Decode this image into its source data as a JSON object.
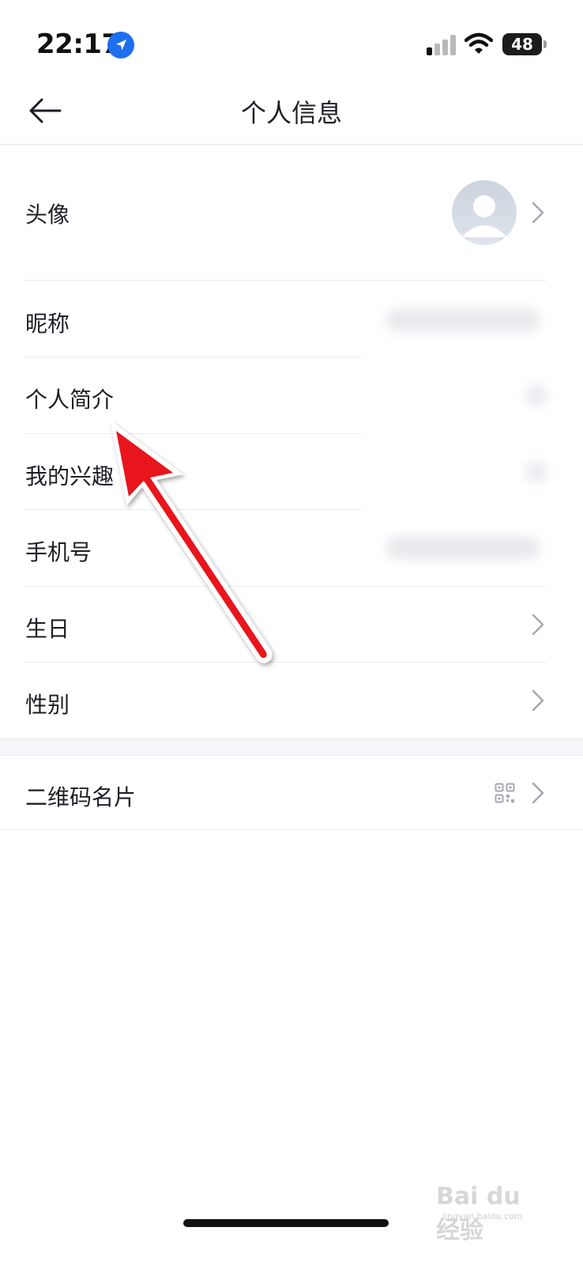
{
  "status_bar": {
    "time": "22:17",
    "battery": "48",
    "icons": [
      "location-arrow-icon",
      "cellular-signal-icon",
      "wifi-icon",
      "battery-icon"
    ]
  },
  "nav": {
    "title": "个人信息",
    "back_icon": "arrow-left-icon"
  },
  "profile_rows": [
    {
      "label": "头像",
      "value_type": "avatar"
    },
    {
      "label": "昵称",
      "value_type": "blurred"
    },
    {
      "label": "个人简介",
      "value_type": "blurred"
    },
    {
      "label": "我的兴趣",
      "value_type": "blurred"
    },
    {
      "label": "手机号",
      "value_type": "blurred"
    },
    {
      "label": "生日",
      "value_type": "chevron"
    },
    {
      "label": "性别",
      "value_type": "chevron"
    }
  ],
  "extra_rows": [
    {
      "label": "二维码名片",
      "icon": "qr-code-icon"
    }
  ],
  "annotation": {
    "type": "red-arrow",
    "color": "#e8141c",
    "points_to": "个人简介"
  },
  "watermark": {
    "logo_text": "Bai du 经验",
    "url": "jingyan.baidu.com"
  },
  "colors": {
    "accent": "#1e6ff0",
    "text": "#1d1f26",
    "divider": "#ececef",
    "section_bg": "#f5f6fa"
  }
}
